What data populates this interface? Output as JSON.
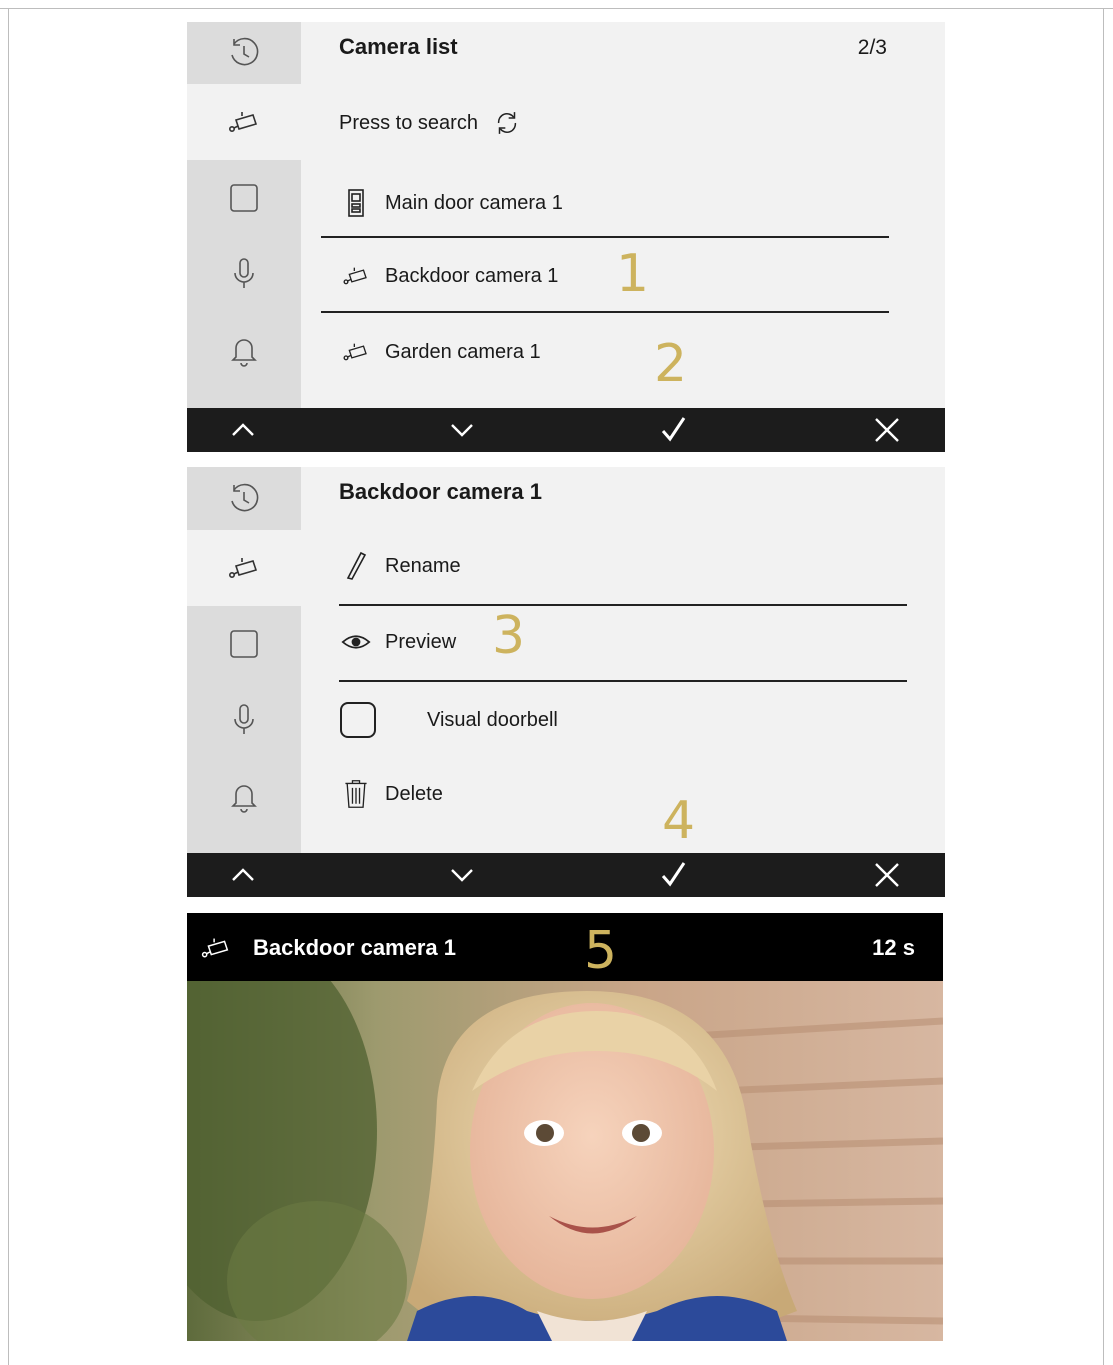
{
  "screen1": {
    "title": "Camera list",
    "pager": "2/3",
    "search_label": "Press to search",
    "items": [
      {
        "label": "Main door camera 1",
        "icon": "door-station-icon"
      },
      {
        "label": "Backdoor camera 1",
        "icon": "camera-icon"
      },
      {
        "label": "Garden camera 1",
        "icon": "camera-icon"
      }
    ]
  },
  "screen2": {
    "title": "Backdoor camera 1",
    "items": [
      {
        "label": "Rename",
        "icon": "pencil-icon"
      },
      {
        "label": "Preview",
        "icon": "eye-icon"
      },
      {
        "label": "Visual doorbell",
        "icon": "checkbox-icon"
      },
      {
        "label": "Delete",
        "icon": "trash-icon"
      }
    ]
  },
  "preview": {
    "title": "Backdoor camera 1",
    "timer": "12 s"
  },
  "callouts": [
    "1",
    "2",
    "3",
    "4",
    "5"
  ],
  "sidebar_icons": [
    "history-icon",
    "camera-icon",
    "square-icon",
    "microphone-icon",
    "bell-icon"
  ],
  "toolbar_icons": [
    "chevron-up-icon",
    "chevron-down-icon",
    "checkmark-icon",
    "close-icon"
  ],
  "colors": {
    "callout": "#cdb35e",
    "toolbar": "#1c1c1c",
    "screen_bg": "#f2f2f2",
    "sidebar_bg": "#dcdcdc"
  }
}
